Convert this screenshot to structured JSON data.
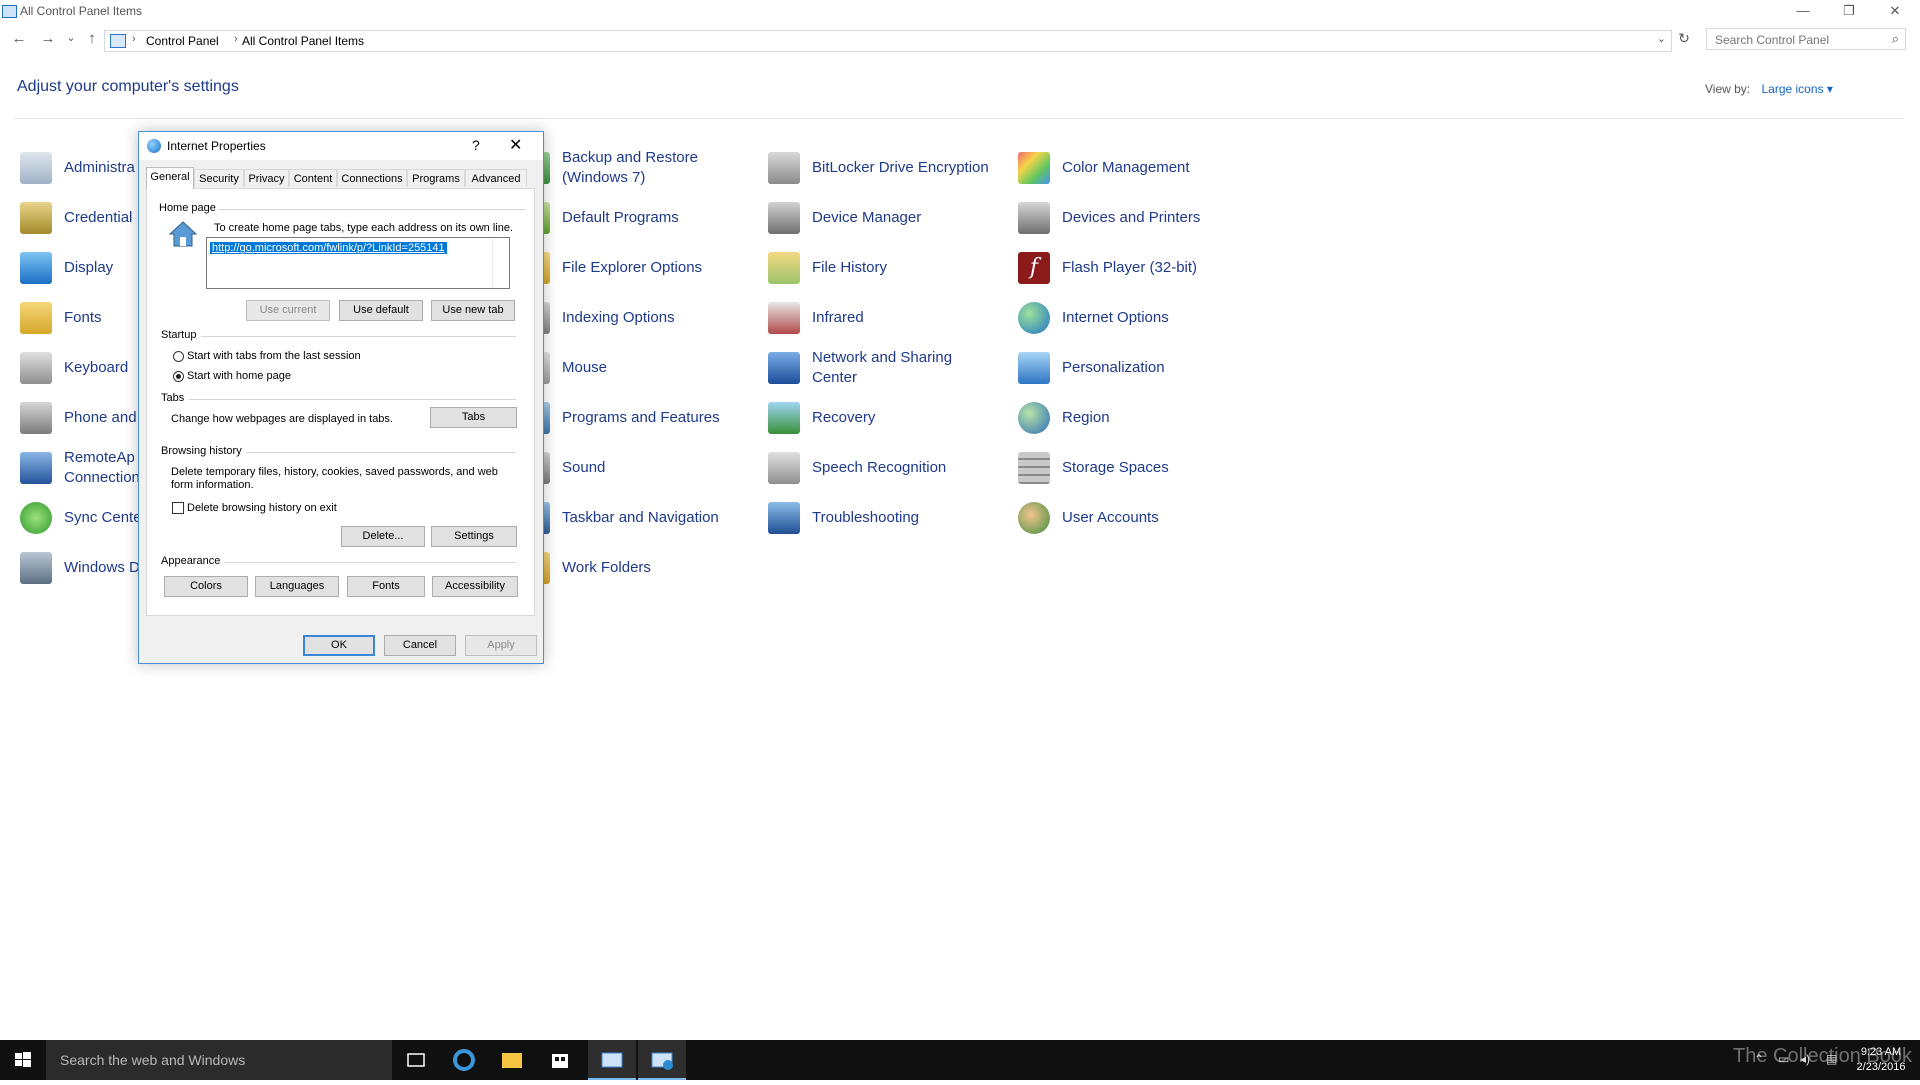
{
  "window": {
    "title": "All Control Panel Items",
    "controls": {
      "minimize": "—",
      "restore": "❐",
      "close": "✕"
    }
  },
  "nav": {
    "back": "←",
    "forward": "→",
    "recent": "⌄",
    "up": "↑",
    "refresh": "↻"
  },
  "breadcrumb": {
    "items": [
      "Control Panel",
      "All Control Panel Items"
    ]
  },
  "search": {
    "placeholder": "Search Control Panel"
  },
  "header": {
    "title": "Adjust your computer's settings",
    "view_by_label": "View by:",
    "view_by_value": "Large icons ▾"
  },
  "items": {
    "col1": [
      {
        "label": "Administra",
        "icon": "admin-tools-icon"
      },
      {
        "label": "Credential",
        "icon": "credential-manager-icon"
      },
      {
        "label": "Display",
        "icon": "display-icon"
      },
      {
        "label": "Fonts",
        "icon": "fonts-icon"
      },
      {
        "label": "Keyboard",
        "icon": "keyboard-icon"
      },
      {
        "label": "Phone and",
        "icon": "phone-modem-icon"
      },
      {
        "label": "RemoteAp\nConnection",
        "icon": "remoteapp-icon"
      },
      {
        "label": "Sync Cente",
        "icon": "sync-center-icon"
      },
      {
        "label": "Windows D",
        "icon": "windows-defender-icon"
      }
    ],
    "col2": [
      {
        "label": "Backup and Restore\n(Windows 7)",
        "icon": "backup-restore-icon"
      },
      {
        "label": "Default Programs",
        "icon": "default-programs-icon"
      },
      {
        "label": "File Explorer Options",
        "icon": "file-explorer-options-icon"
      },
      {
        "label": "Indexing Options",
        "icon": "indexing-options-icon"
      },
      {
        "label": "Mouse",
        "icon": "mouse-icon"
      },
      {
        "label": "Programs and Features",
        "icon": "programs-features-icon"
      },
      {
        "label": "Sound",
        "icon": "sound-icon"
      },
      {
        "label": "Taskbar and Navigation",
        "icon": "taskbar-navigation-icon"
      },
      {
        "label": "Work Folders",
        "icon": "work-folders-icon"
      }
    ],
    "col3": [
      {
        "label": "BitLocker Drive Encryption",
        "icon": "bitlocker-icon"
      },
      {
        "label": "Device Manager",
        "icon": "device-manager-icon"
      },
      {
        "label": "File History",
        "icon": "file-history-icon"
      },
      {
        "label": "Infrared",
        "icon": "infrared-icon"
      },
      {
        "label": "Network and Sharing\nCenter",
        "icon": "network-sharing-icon"
      },
      {
        "label": "Recovery",
        "icon": "recovery-icon"
      },
      {
        "label": "Speech Recognition",
        "icon": "speech-recognition-icon"
      },
      {
        "label": "Troubleshooting",
        "icon": "troubleshooting-icon"
      }
    ],
    "col4": [
      {
        "label": "Color Management",
        "icon": "color-management-icon"
      },
      {
        "label": "Devices and Printers",
        "icon": "devices-printers-icon"
      },
      {
        "label": "Flash Player (32-bit)",
        "icon": "flash-player-icon"
      },
      {
        "label": "Internet Options",
        "icon": "internet-options-icon"
      },
      {
        "label": "Personalization",
        "icon": "personalization-icon"
      },
      {
        "label": "Region",
        "icon": "region-icon"
      },
      {
        "label": "Storage Spaces",
        "icon": "storage-spaces-icon"
      },
      {
        "label": "User Accounts",
        "icon": "user-accounts-icon"
      }
    ]
  },
  "dialog": {
    "title": "Internet Properties",
    "help": "?",
    "close": "✕",
    "tabs": [
      "General",
      "Security",
      "Privacy",
      "Content",
      "Connections",
      "Programs",
      "Advanced"
    ],
    "home_page": {
      "group": "Home page",
      "hint": "To create home page tabs, type each address on its own line.",
      "url": "http://go.microsoft.com/fwlink/p/?LinkId=255141",
      "use_current": "Use current",
      "use_default": "Use default",
      "use_new_tab": "Use new tab"
    },
    "startup": {
      "group": "Startup",
      "option_last_session": "Start with tabs from the last session",
      "option_home_page": "Start with home page"
    },
    "tabs_group": {
      "group": "Tabs",
      "text": "Change how webpages are displayed in tabs.",
      "button": "Tabs"
    },
    "browsing_history": {
      "group": "Browsing history",
      "text": "Delete temporary files, history, cookies, saved passwords, and web form information.",
      "checkbox": "Delete browsing history on exit",
      "delete": "Delete...",
      "settings": "Settings"
    },
    "appearance": {
      "group": "Appearance",
      "colors": "Colors",
      "languages": "Languages",
      "fonts": "Fonts",
      "accessibility": "Accessibility"
    },
    "footer": {
      "ok": "OK",
      "cancel": "Cancel",
      "apply": "Apply"
    }
  },
  "taskbar": {
    "search_placeholder": "Search the web and Windows",
    "clock_time": "9:23 AM",
    "clock_date": "2/23/2016",
    "watermark": "The Collection Book"
  },
  "colors": {
    "link": "#1e3a8a",
    "accent": "#0078d7",
    "taskbar": "#101010"
  }
}
